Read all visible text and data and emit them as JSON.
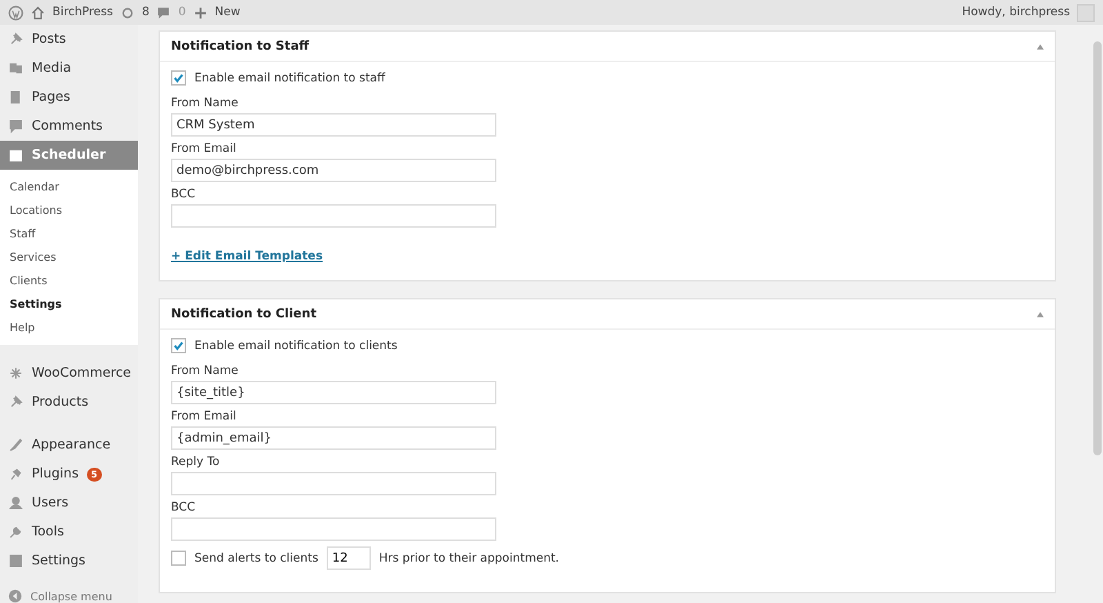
{
  "admin_bar": {
    "site": "BirchPress",
    "updates": "8",
    "comments": "0",
    "new": "New",
    "greeting": "Howdy, birchpress"
  },
  "sidebar": {
    "sections": [
      {
        "items": [
          {
            "label": "Posts",
            "selected": false
          },
          {
            "label": "Media",
            "selected": false
          },
          {
            "label": "Pages",
            "selected": false
          },
          {
            "label": "Comments",
            "selected": false
          },
          {
            "label": "Scheduler",
            "selected": true,
            "children": [
              {
                "label": "Calendar",
                "selected": false
              },
              {
                "label": "Locations",
                "selected": false
              },
              {
                "label": "Staff",
                "selected": false
              },
              {
                "label": "Services",
                "selected": false
              },
              {
                "label": "Clients",
                "selected": false
              },
              {
                "label": "Settings",
                "selected": true
              },
              {
                "label": "Help",
                "selected": false
              }
            ]
          }
        ]
      },
      {
        "items": [
          {
            "label": "WooCommerce",
            "selected": false
          },
          {
            "label": "Products",
            "selected": false
          }
        ]
      },
      {
        "items": [
          {
            "label": "Appearance",
            "selected": false
          },
          {
            "label": "Plugins",
            "selected": false,
            "badge": "5"
          },
          {
            "label": "Users",
            "selected": false
          },
          {
            "label": "Tools",
            "selected": false
          },
          {
            "label": "Settings",
            "selected": false
          }
        ]
      }
    ],
    "collapse": "Collapse menu"
  },
  "panels": [
    {
      "title": "Notification to Staff",
      "fields": [
        {
          "kind": "checkbox",
          "label": "Enable email notification to staff",
          "checked": true
        },
        {
          "kind": "text",
          "label": "From Name",
          "value": "CRM System"
        },
        {
          "kind": "text",
          "label": "From Email",
          "value": "demo@birchpress.com"
        },
        {
          "kind": "text",
          "label": "BCC"
        },
        {
          "kind": "link",
          "label": "+ Edit Email Templates"
        }
      ]
    },
    {
      "title": "Notification to Client",
      "fields": [
        {
          "kind": "checkbox",
          "label": "Enable email notification to clients",
          "checked": true
        },
        {
          "kind": "text",
          "label": "From Name",
          "value": "{site_title}"
        },
        {
          "kind": "text",
          "label": "From Email",
          "value": "{admin_email}"
        },
        {
          "kind": "text",
          "label": "Reply To"
        },
        {
          "kind": "text",
          "label": "BCC"
        },
        {
          "kind": "alert",
          "label": "Send alerts to clients",
          "value": "12",
          "suffix": "Hrs prior to their appointment.",
          "checked": false
        }
      ]
    }
  ]
}
